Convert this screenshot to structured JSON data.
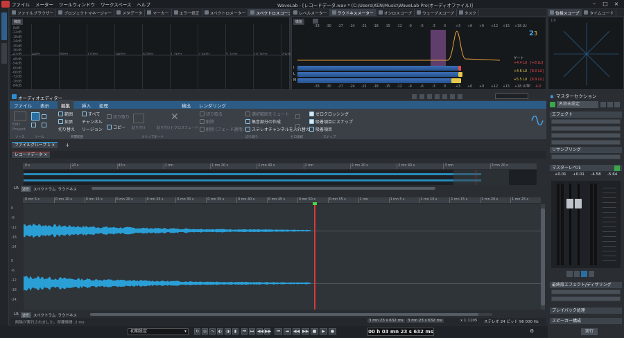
{
  "window": {
    "title": "WaveLab - [レコードデータ.wav * (C:\\Users\\XEN\\Music\\WaveLab Pro\\オーディオファイル)]"
  },
  "menu": [
    "ファイル",
    "メーター",
    "ツールウィンドウ",
    "ワークスペース",
    "ヘルプ"
  ],
  "top_tabs_left": [
    "ファイルブラウザー",
    "プロジェクトマネージャー",
    "メタデータ",
    "マーカー",
    "エラー修正",
    "スペクトロメーター",
    "スペクトロスコープ"
  ],
  "top_tabs_mid": [
    "レベルメーター",
    "ラウドネスメーター",
    "オシロスコープ",
    "ウェーブスコープ",
    "タスク"
  ],
  "top_tabs_right": [
    "位相スコープ",
    "タイムコード"
  ],
  "spectro": {
    "func_label": "機能",
    "freq_ticks": [
      "44Hz",
      "88Hz",
      "170Hz",
      "340Hz",
      "670Hz",
      "1.3kHz",
      "2.6kHz",
      "5.1kHz",
      "10.3kHz",
      "20kHz"
    ],
    "db_ticks": [
      "-6dB",
      "-12dB",
      "-18dB",
      "-24dB",
      "-30dB",
      "-36dB",
      "-42dB",
      "-48dB",
      "-54dB",
      "-60dB",
      "-66dB",
      "-72dB",
      "-78dB",
      "-84dB"
    ]
  },
  "loudness": {
    "func_label": "機能",
    "scale": [
      "-33",
      "-30",
      "-27",
      "-24",
      "-21",
      "-18",
      "-15",
      "-12",
      "-9",
      "-6",
      "-3",
      "0",
      "+3",
      "+6",
      "+9",
      "+12",
      "+15",
      "+18 LU"
    ],
    "gate_label": "ゲート",
    "rows": [
      {
        "label": "I",
        "value": "+4.4 LU",
        "peak": "[+8 LU]",
        "color": "#e84a4a"
      },
      {
        "label": "L",
        "value": "+4.6 LU",
        "peak": "[8.0 LU]",
        "color": "#e8c84a"
      },
      {
        "label": "M",
        "value": "+5.5 LU",
        "peak": "[6.9 LU]",
        "color": "#e8c84a"
      }
    ],
    "tp_label": "TP",
    "tp_value": "-4.0"
  },
  "phase": {
    "label": "1/9"
  },
  "editor": {
    "title": "オーディオエディター",
    "tabs": [
      "ファイル",
      "表示",
      "編集",
      "挿入",
      "処理",
      "検出",
      "レンダリング"
    ],
    "active_tab": "編集"
  },
  "ribbon": {
    "source": {
      "label": "Edit Project",
      "group": "ソース"
    },
    "tool_group": "ツール",
    "timeselect": {
      "items": [
        "範囲",
        "拡張",
        "切り替え",
        "すべて",
        "チャンネル",
        "リージョン"
      ],
      "group": "時間範囲"
    },
    "clipboard": {
      "items": [
        "切り取り",
        "コピー",
        "貼り付け",
        "貼り付けとクロスフェード"
      ],
      "group": "クリップボード"
    },
    "delete": {
      "items": [
        "切り取る",
        "削除",
        "削除 (フェード適用)"
      ],
      "group": ""
    },
    "cut": {
      "items": [
        "選択範囲をミュート",
        "無音部分の作成",
        "ステレオチャンネルを入れ替え"
      ],
      "group": "切り取り"
    },
    "snap": {
      "items": [
        "ゼロクロッシング",
        "吸着項目にスナップ",
        "吸着項目"
      ],
      "group": "スナップ"
    },
    "zero_group": "ゼロ連結"
  },
  "filegroup": {
    "label": "ファイルグループ 1",
    "add": "+"
  },
  "file_tab": "レコードデータ",
  "overview_ruler": [
    "0 s",
    "20 s",
    "40 s",
    "1 mn",
    "1 mn 20 s",
    "1 mn 40 s",
    "2 mn",
    "2 mn 20 s",
    "2 mn 40 s",
    "3 mn",
    "3 mn 20 s"
  ],
  "main_ruler": [
    "0 mn 5 s",
    "0 mn 10 s",
    "0 mn 15 s",
    "0 mn 20 s",
    "0 mn 25 s",
    "0 mn 30 s",
    "0 mn 35 s",
    "0 mn 40 s",
    "0 mn 45 s",
    "0 mn 50 s",
    "0 mn 55 s",
    "1 mn",
    "1 mn 5 s",
    "1 mn 10 s",
    "1 mn 15 s",
    "1 mn 20 s",
    "1 mn 25 s"
  ],
  "view_tabs": [
    "LR",
    "波形",
    "スペクトラム",
    "ラウドネス"
  ],
  "db_scale": [
    "0",
    "-6",
    "-12",
    "-18",
    "-24"
  ],
  "status": {
    "left": "削除が実行されました。所要時間: 2 ms",
    "time1": "3 mn 23 s 632 ms",
    "time2": "3 mn 23 s 632 ms",
    "zoom": "x 1:1105",
    "format": "ステレオ 24 ビット 96 000 Hz"
  },
  "transport": {
    "preset": "初期設定",
    "time": "00 h 03 mn 23 s 632 ms"
  },
  "master": {
    "title": "マスターセクション",
    "preset_label": "名称未設定",
    "effects_label": "エフェクト",
    "resampling_label": "リサンプリング",
    "level_label": "マスターレベル",
    "level_values": [
      "+0.01",
      "+0.01",
      "-4.58",
      "-5.64"
    ],
    "final_label": "最終段エフェクト/ディザリング",
    "playback_label": "プレイバック処理",
    "speaker_label": "スピーカー構成",
    "render_label": "実行"
  },
  "colors": {
    "accent": "#2c5c86",
    "waveform": "#2a9fd6",
    "cursor": "#d63a3a",
    "loudness_line": "#e8a03a"
  }
}
